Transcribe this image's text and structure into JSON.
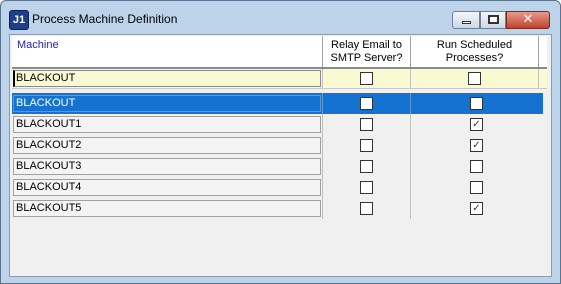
{
  "window": {
    "title": "Process Machine Definition",
    "icon_label": "J1",
    "icon": "j1-app-icon",
    "controls": [
      "minimize-icon",
      "maximize-icon",
      "close-icon"
    ],
    "close_glyph": "✕"
  },
  "grid": {
    "columns": {
      "machine": "Machine",
      "relay": "Relay Email to SMTP Server?",
      "run": "Run Scheduled Processes?"
    },
    "filter": {
      "machine_value": "BLACKOUT",
      "relay_checked": false,
      "run_checked": false
    },
    "rows": [
      {
        "machine": "BLACKOUT",
        "relay": false,
        "run": false,
        "selected": true
      },
      {
        "machine": "BLACKOUT1",
        "relay": false,
        "run": true,
        "selected": false
      },
      {
        "machine": "BLACKOUT2",
        "relay": false,
        "run": true,
        "selected": false
      },
      {
        "machine": "BLACKOUT3",
        "relay": false,
        "run": false,
        "selected": false
      },
      {
        "machine": "BLACKOUT4",
        "relay": false,
        "run": false,
        "selected": false
      },
      {
        "machine": "BLACKOUT5",
        "relay": false,
        "run": true,
        "selected": false
      }
    ],
    "check_glyph": "✓"
  },
  "colors": {
    "selected_row": "#1672d0",
    "filter_row": "#fafad2",
    "header_text": "#2323b8"
  }
}
